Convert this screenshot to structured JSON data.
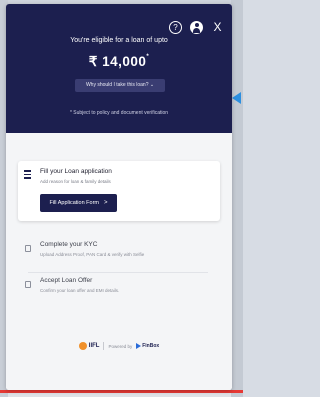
{
  "header": {
    "help_icon": "question-icon",
    "user_icon": "user-icon",
    "close_label": "X",
    "eligible_text": "You're eligible for a loan of upto",
    "amount": "₹ 14,000",
    "amount_suffix": "*",
    "why_label": "Why should I take this loan? ⌄",
    "subject_note": "* Subject to policy and document verification"
  },
  "steps": {
    "step1_title": "Fill your Loan application",
    "step1_sub": "Add reason for loan & family details",
    "step1_button": "Fill Application Form",
    "step1_chevron": ">",
    "step2_title": "Complete your KYC",
    "step2_sub": "Upload Address Proof, PAN Card & verify with Selfie",
    "step3_title": "Accept Loan Offer",
    "step3_sub": "Confirm your loan offer and EMI details."
  },
  "footer": {
    "brand": "IIFL",
    "powered": "Powered by",
    "partner": "FinBox"
  },
  "colors": {
    "header_bg": "#1c1f4f",
    "button_bg": "#1c1f4f",
    "accent_arrow": "#2d8fe0",
    "bottom_line": "#e53935"
  }
}
